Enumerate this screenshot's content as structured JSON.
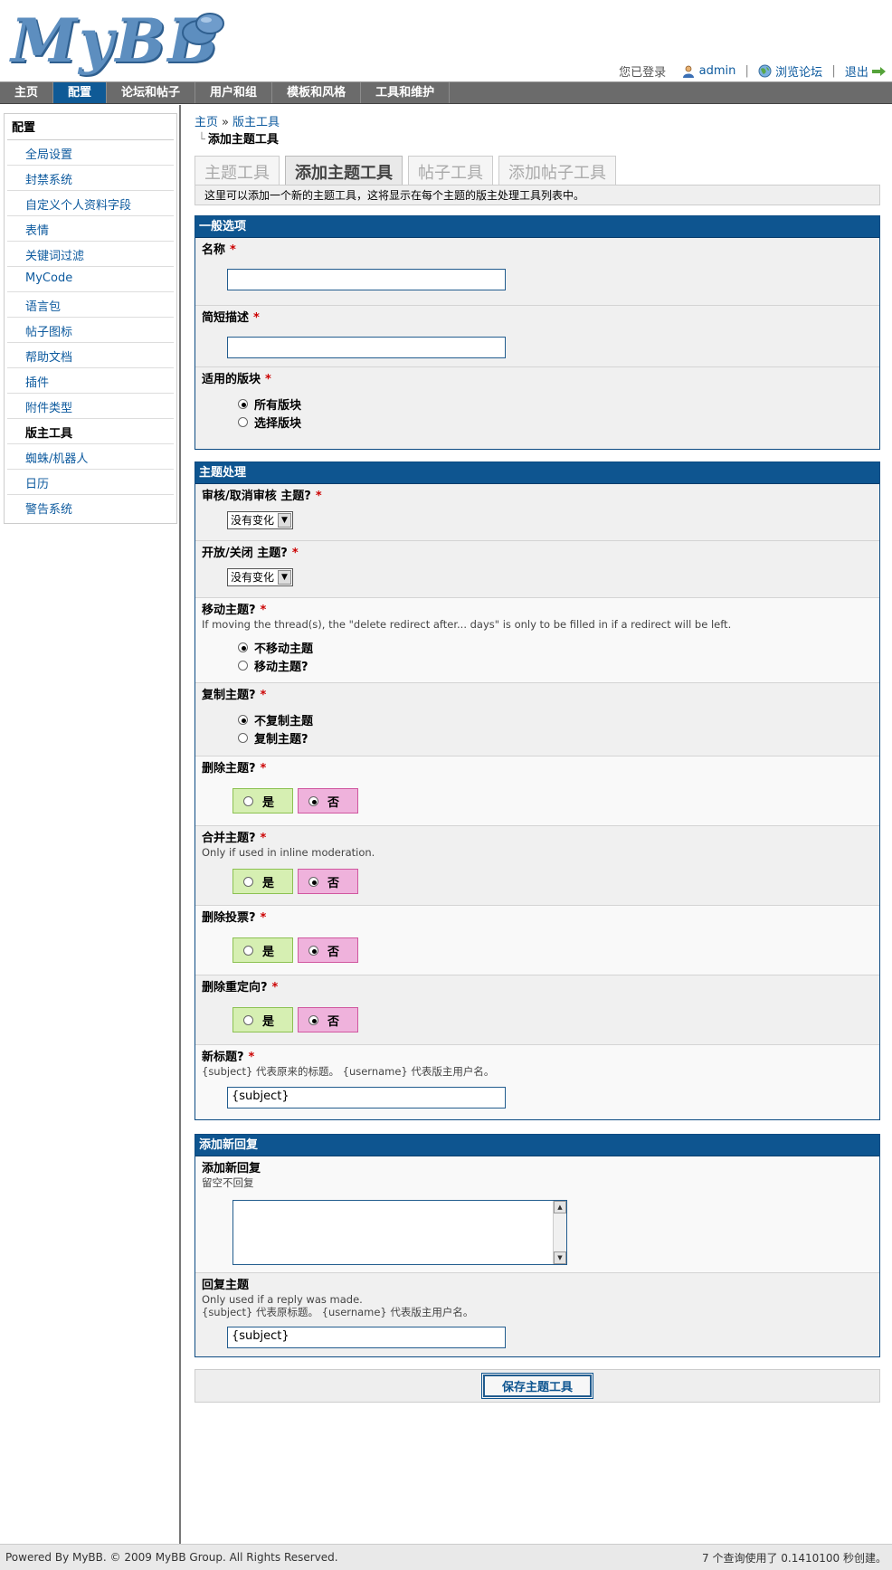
{
  "header": {
    "logo": "MyBB",
    "welcome": "您已登录",
    "username": "admin",
    "view_board": "浏览论坛",
    "logout": "退出"
  },
  "menu": {
    "items": [
      "主页",
      "配置",
      "论坛和帖子",
      "用户和组",
      "模板和风格",
      "工具和维护"
    ],
    "active": "配置"
  },
  "sidebar": {
    "title": "配置",
    "items": [
      "全局设置",
      "封禁系统",
      "自定义个人资料字段",
      "表情",
      "关键词过滤",
      "MyCode",
      "语言包",
      "帖子图标",
      "帮助文档",
      "插件",
      "附件类型",
      "版主工具",
      "蜘蛛/机器人",
      "日历",
      "警告系统"
    ],
    "current": "版主工具"
  },
  "breadcrumb": {
    "home": "主页",
    "sep": "»",
    "section": "版主工具",
    "current": "添加主题工具"
  },
  "tabs": [
    "主题工具",
    "添加主题工具",
    "帖子工具",
    "添加帖子工具"
  ],
  "description": "这里可以添加一个新的主题工具，这将显示在每个主题的版主处理工具列表中。",
  "general": {
    "title": "一般选项",
    "name_label": "名称",
    "desc_label": "简短描述",
    "forums_label": "适用的版块",
    "forum_all": "所有版块",
    "forum_select": "选择版块",
    "required": "*"
  },
  "thread": {
    "title": "主题处理",
    "approve_label": "审核/取消审核  主题?",
    "open_label": "开放/关闭  主题?",
    "select_value": "没有变化",
    "move_label": "移动主题?",
    "move_hint": "If moving the thread(s), the \"delete redirect after... days\" is only to be filled in if a redirect will be left.",
    "move_no": "不移动主题",
    "move_yes": "移动主题?",
    "copy_label": "复制主题?",
    "copy_no": "不复制主题",
    "copy_yes": "复制主题?",
    "delete_label": "删除主题?",
    "merge_label": "合并主题?",
    "merge_hint": "Only if used in inline moderation.",
    "poll_label": "删除投票?",
    "redirect_label": "删除重定向?",
    "yes": "是",
    "no": "否",
    "newsubject_label": "新标题?",
    "newsubject_hint": "{subject} 代表原来的标题。 {username} 代表版主用户名。",
    "newsubject_value": "{subject}"
  },
  "reply": {
    "title": "添加新回复",
    "reply_label": "添加新回复",
    "reply_hint": "留空不回复",
    "subject_label": "回复主题",
    "subject_hint1": "Only used if a reply was made.",
    "subject_hint2": "{subject} 代表原标题。 {username} 代表版主用户名。",
    "subject_value": "{subject}"
  },
  "submit": "保存主题工具",
  "footer": {
    "left": "Powered By MyBB. © 2009 MyBB Group. All Rights Reserved.",
    "right": "7 个查询使用了 0.1410100 秒创建。"
  },
  "colors": {
    "nav_bg": "#6b6b6b",
    "accent": "#0e5590",
    "yes_bg": "#d6efb2",
    "no_bg": "#efb2dc",
    "required": "#cc0000"
  }
}
